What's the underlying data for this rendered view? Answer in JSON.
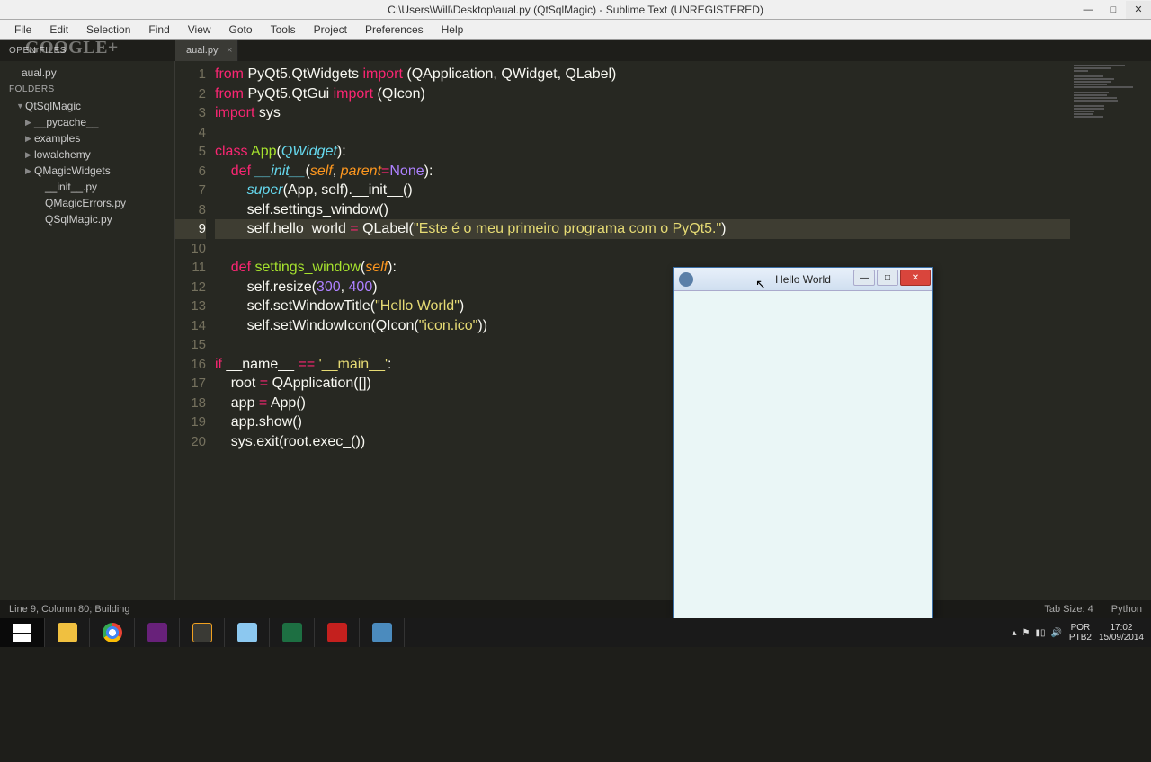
{
  "titlebar": {
    "title": "C:\\Users\\Will\\Desktop\\aual.py (QtSqlMagic) - Sublime Text (UNREGISTERED)",
    "minimize": "—",
    "maximize": "□",
    "close": "✕"
  },
  "menu": {
    "items": [
      "File",
      "Edit",
      "Selection",
      "Find",
      "View",
      "Goto",
      "Tools",
      "Project",
      "Preferences",
      "Help"
    ]
  },
  "openfiles_label": "OPEN FILES",
  "google_overlay": "Google+",
  "open_file": "aual.py",
  "sidebar": {
    "section": "FOLDERS",
    "items": [
      {
        "label": "QtSqlMagic",
        "indent": 0,
        "arrow": "▼"
      },
      {
        "label": "__pycache__",
        "indent": 1,
        "arrow": "▶"
      },
      {
        "label": "examples",
        "indent": 1,
        "arrow": "▶"
      },
      {
        "label": "lowalchemy",
        "indent": 1,
        "arrow": "▶"
      },
      {
        "label": "QMagicWidgets",
        "indent": 1,
        "arrow": "▶"
      },
      {
        "label": "__init__.py",
        "indent": 2,
        "arrow": ""
      },
      {
        "label": "QMagicErrors.py",
        "indent": 2,
        "arrow": ""
      },
      {
        "label": "QSqlMagic.py",
        "indent": 2,
        "arrow": ""
      }
    ]
  },
  "tabs": [
    {
      "label": "aual.py"
    }
  ],
  "code": {
    "active_line": 9,
    "lines": [
      1,
      2,
      3,
      4,
      5,
      6,
      7,
      8,
      9,
      10,
      11,
      12,
      13,
      14,
      15,
      16,
      17,
      18,
      19,
      20
    ]
  },
  "popup": {
    "title": "Hello World",
    "minimize": "—",
    "maximize": "□",
    "close": "✕"
  },
  "statusbar": {
    "left": "Line 9, Column 80; Building",
    "tab_size": "Tab Size: 4",
    "syntax": "Python"
  },
  "tray": {
    "lang": "POR",
    "kbd": "PTB2",
    "time": "17:02",
    "date": "15/09/2014"
  }
}
